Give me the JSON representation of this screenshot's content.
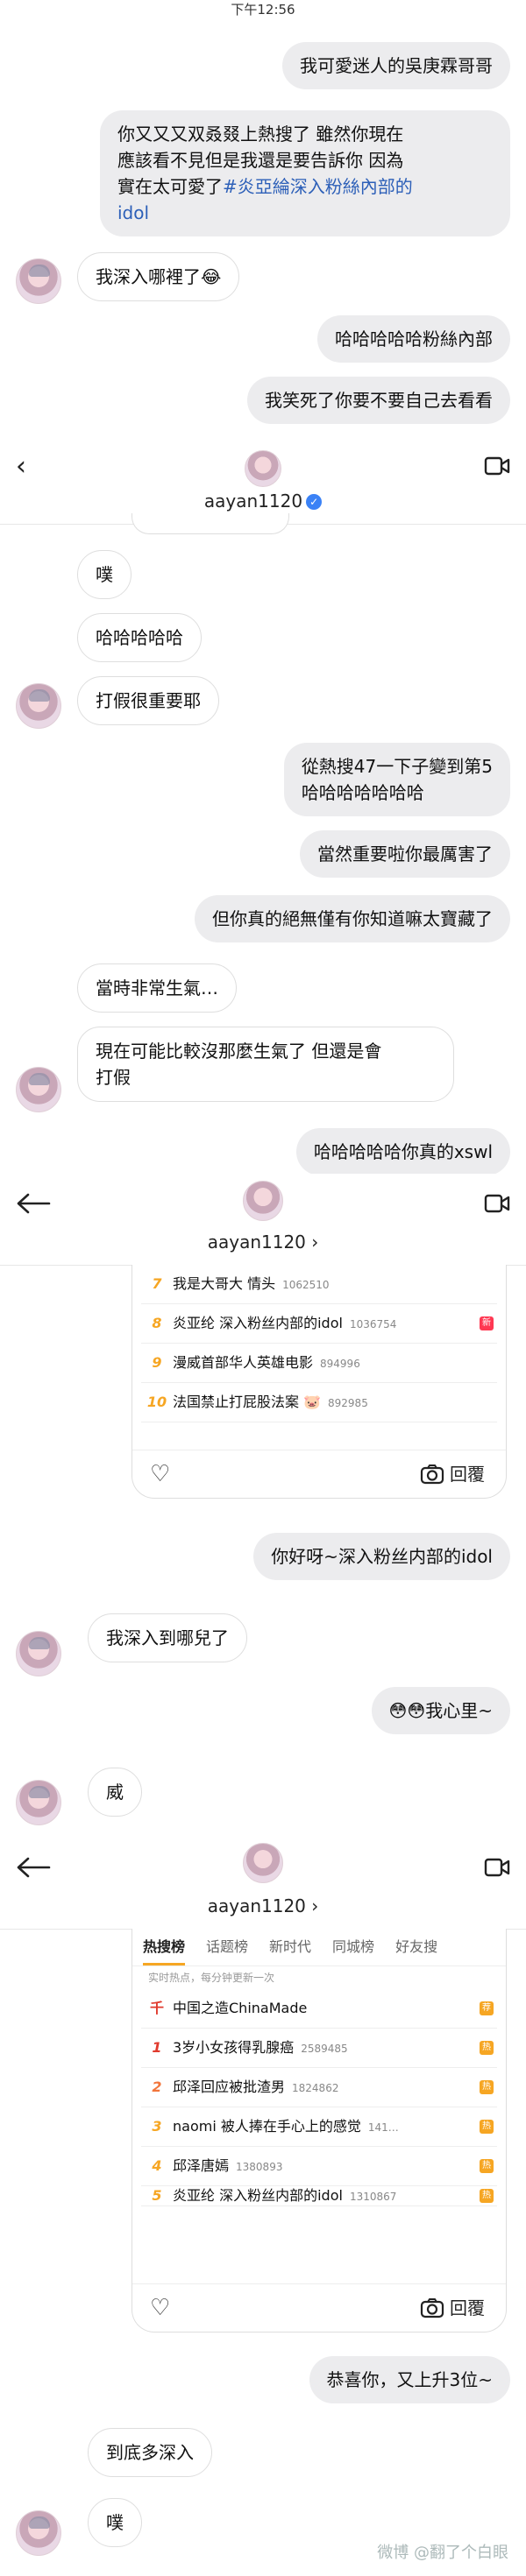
{
  "status_time": "下午12:56",
  "username": "aayan1120",
  "username_arrow": "aayan1120 ›",
  "messages": {
    "m1": "我可愛迷人的吳庚霖哥哥",
    "m2a": "你又又又双叒叕上熱搜了 雖然你現在",
    "m2b": "應該看不見但是我還是要告訴你 因為",
    "m2c_pre": "實在太可愛了",
    "m2c_link": "#炎亞綸深入粉絲內部的",
    "m2d_link": "idol",
    "m3": "我深入哪裡了😂",
    "m4": "哈哈哈哈哈粉絲內部",
    "m5": "我笑死了你要不要自己去看看",
    "m6": "噗",
    "m7": "哈哈哈哈哈",
    "m8": "打假很重要耶",
    "m9a": "從熱搜47一下子變到第5",
    "m9b": "哈哈哈哈哈哈哈",
    "m10": "當然重要啦你最厲害了",
    "m11": "但你真的絕無僅有你知道嘛太寶藏了",
    "m12": "當時非常生氣…",
    "m13a": "現在可能比較沒那麼生氣了 但還是會",
    "m13b": "打假",
    "m14": "哈哈哈哈哈你真的xswl",
    "m15": "你好呀~深入粉丝内部的idol",
    "m16": "我深入到哪兒了",
    "m17": "😳😳我心里~",
    "m18": "威",
    "m19": "恭喜你，又上升3位~",
    "m20": "到底多深入",
    "m21": "噗"
  },
  "hot1": [
    {
      "rank": "7",
      "title": "我是大哥大 情头",
      "count": "1062510",
      "tag": ""
    },
    {
      "rank": "8",
      "title": "炎亚纶 深入粉丝内部的idol",
      "count": "1036754",
      "tag": "新"
    },
    {
      "rank": "9",
      "title": "漫威首部华人英雄电影",
      "count": "894996",
      "tag": ""
    },
    {
      "rank": "10",
      "title": "法国禁止打屁股法案 🐷",
      "count": "892985",
      "tag": ""
    }
  ],
  "hot2_tabs": [
    "热搜榜",
    "话题榜",
    "新时代",
    "同城榜",
    "好友搜"
  ],
  "hot2_subhead": "实时热点，每分钟更新一次",
  "hot2": [
    {
      "rank": "千",
      "title": "中国之造ChinaMade",
      "count": "",
      "tag": "荐"
    },
    {
      "rank": "1",
      "title": "3岁小女孩得乳腺癌",
      "count": "2589485",
      "tag": "热"
    },
    {
      "rank": "2",
      "title": "邱泽回应被批渣男",
      "count": "1824862",
      "tag": "热"
    },
    {
      "rank": "3",
      "title": "naomi 被人捧在手心上的感觉",
      "count": "141…",
      "tag": "热"
    },
    {
      "rank": "4",
      "title": "邱泽唐嫣",
      "count": "1380893",
      "tag": "热"
    },
    {
      "rank": "5",
      "title": "炎亚纶 深入粉丝内部的idol",
      "count": "1310867",
      "tag": "热"
    }
  ],
  "reply_label": "回覆",
  "watermark": "微博 @翻了个白眼"
}
